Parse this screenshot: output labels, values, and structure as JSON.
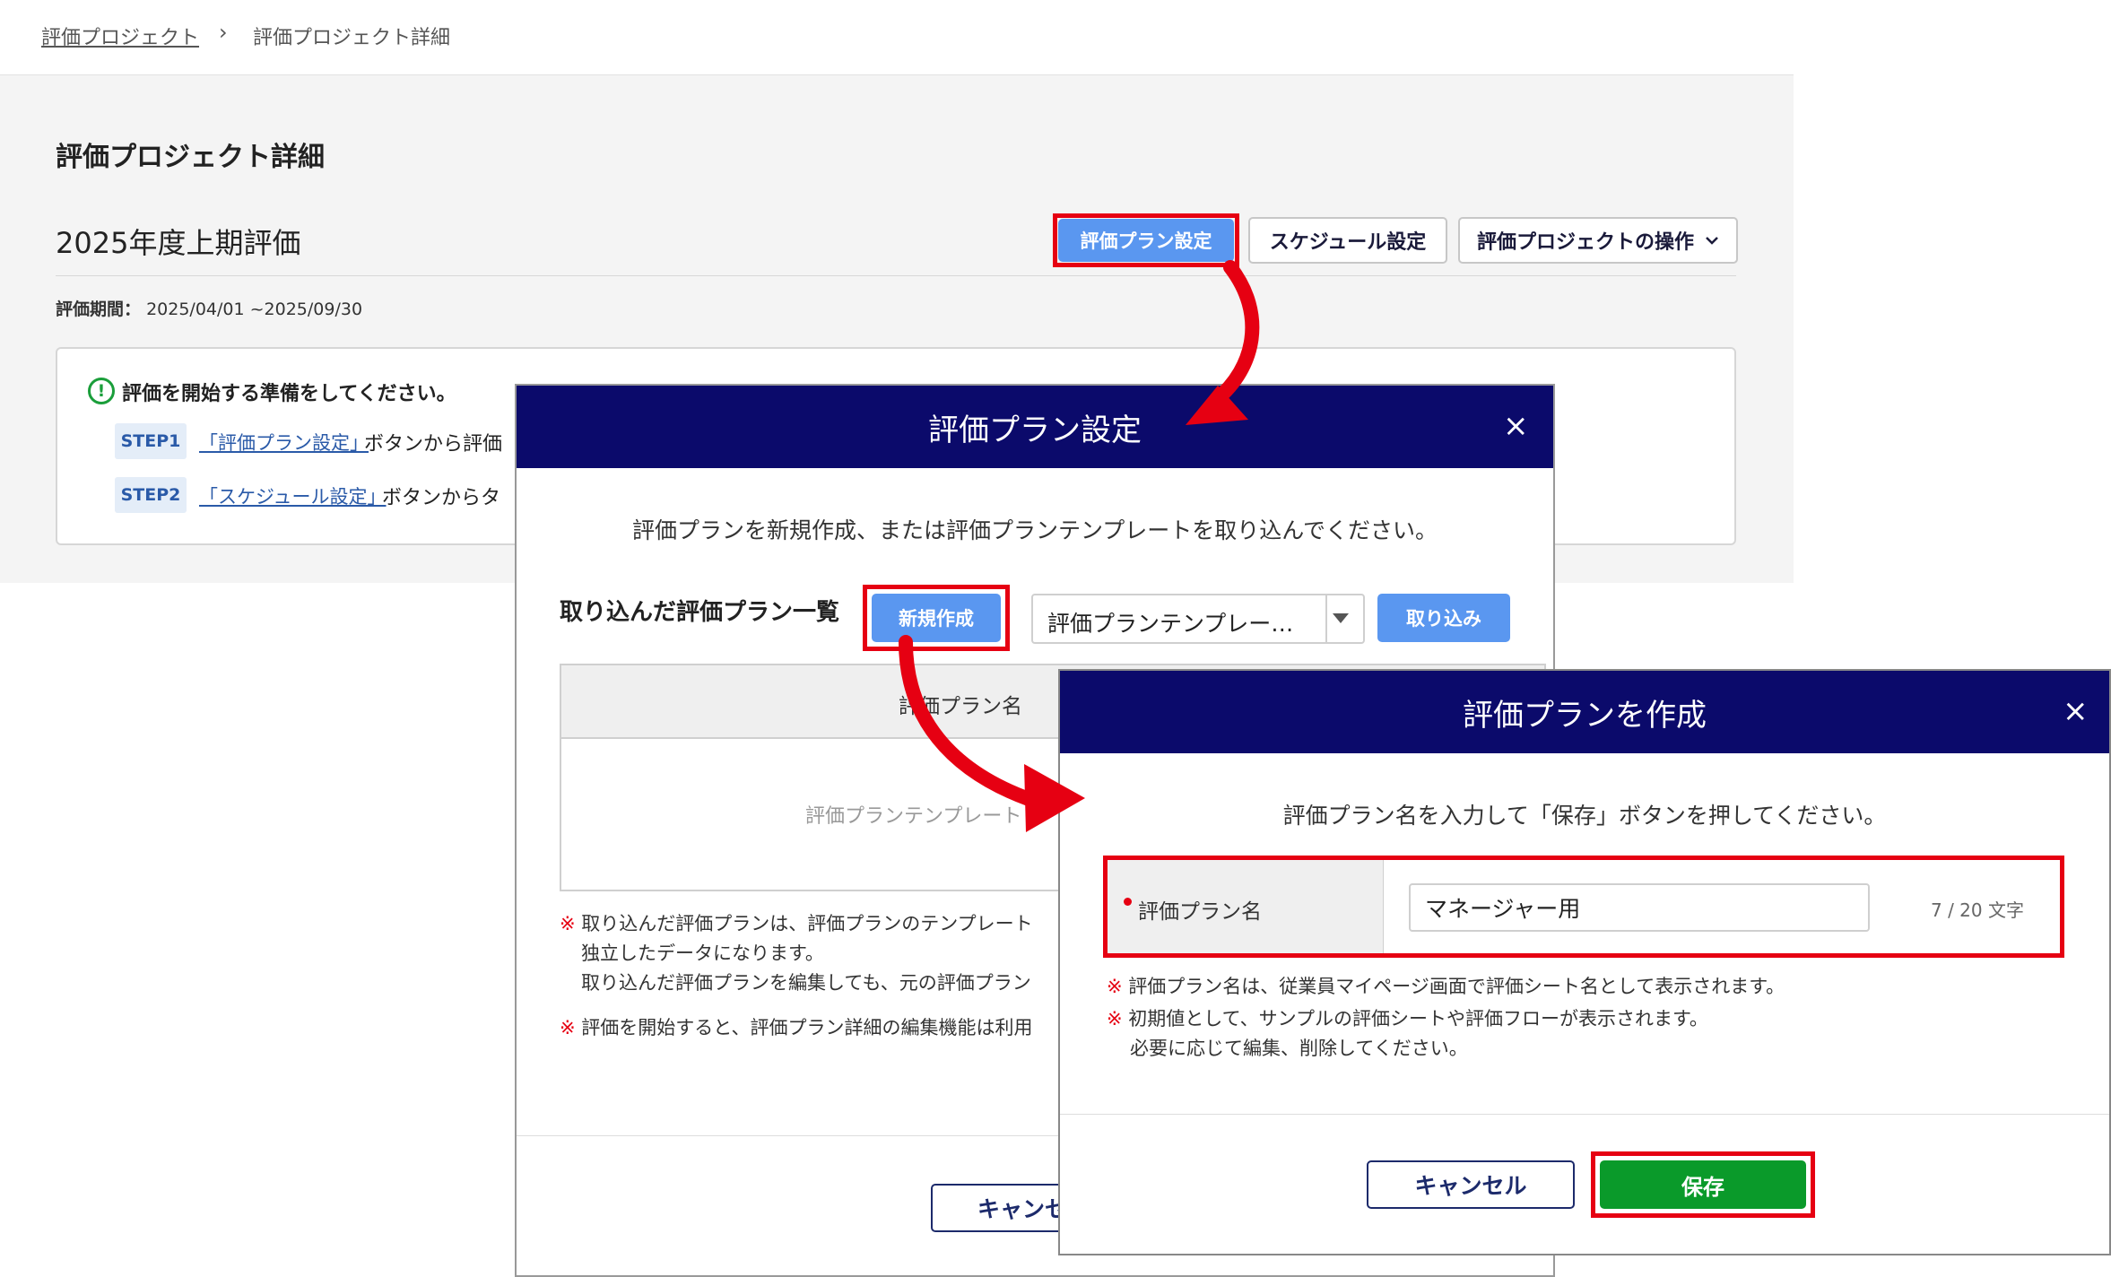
{
  "breadcrumb": {
    "parent": "評価プロジェクト",
    "separator": "›",
    "current": "評価プロジェクト詳細"
  },
  "page": {
    "title": "評価プロジェクト詳細",
    "project_name": "2025年度上期評価",
    "period_label": "評価期間：",
    "period_value": "2025/04/01 ~2025/09/30"
  },
  "toolbar": {
    "plan_settings": "評価プラン設定",
    "schedule_settings": "スケジュール設定",
    "project_actions": "評価プロジェクトの操作"
  },
  "notice": {
    "title": "評価を開始する準備をしてください。",
    "steps": [
      {
        "tag": "STEP1",
        "link": "「評価プラン設定」",
        "text": "ボタンから評価"
      },
      {
        "tag": "STEP2",
        "link": "「スケジュール設定」",
        "text": "ボタンからタ"
      }
    ]
  },
  "plan_modal": {
    "title": "評価プラン設定",
    "close": "×",
    "instruction": "評価プランを新規作成、または評価プランテンプレートを取り込んでください。",
    "list_label": "取り込んだ評価プラン一覧",
    "new_button": "新規作成",
    "template_select": "評価プランテンプレー…",
    "import_button": "取り込み",
    "table_header": "評価プラン名",
    "table_empty": "評価プランテンプレート",
    "notes": [
      {
        "mark": "※",
        "lines": [
          "取り込んだ評価プランは、評価プランのテンプレート",
          "独立したデータになります。",
          "取り込んだ評価プランを編集しても、元の評価プラン"
        ]
      },
      {
        "mark": "※",
        "lines": [
          "評価を開始すると、評価プラン詳細の編集機能は利用"
        ]
      }
    ],
    "cancel_button": "キャンセ"
  },
  "create_modal": {
    "title": "評価プランを作成",
    "close": "×",
    "instruction": "評価プラン名を入力して「保存」ボタンを押してください。",
    "field_label": "評価プラン名",
    "field_value": "マネージャー用",
    "char_count": "7 / 20 文字",
    "notes": [
      {
        "mark": "※",
        "lines": [
          "評価プラン名は、従業員マイページ画面で評価シート名として表示されます。"
        ]
      },
      {
        "mark": "※",
        "lines": [
          "初期値として、サンプルの評価シートや評価フローが表示されます。",
          "必要に応じて編集、削除してください。"
        ]
      }
    ],
    "cancel_button": "キャンセル",
    "save_button": "保存"
  },
  "colors": {
    "modal_header": "#0b0a6b",
    "primary_button": "#5a97f0",
    "save_button": "#0a9a2a",
    "highlight": "#e60012"
  }
}
